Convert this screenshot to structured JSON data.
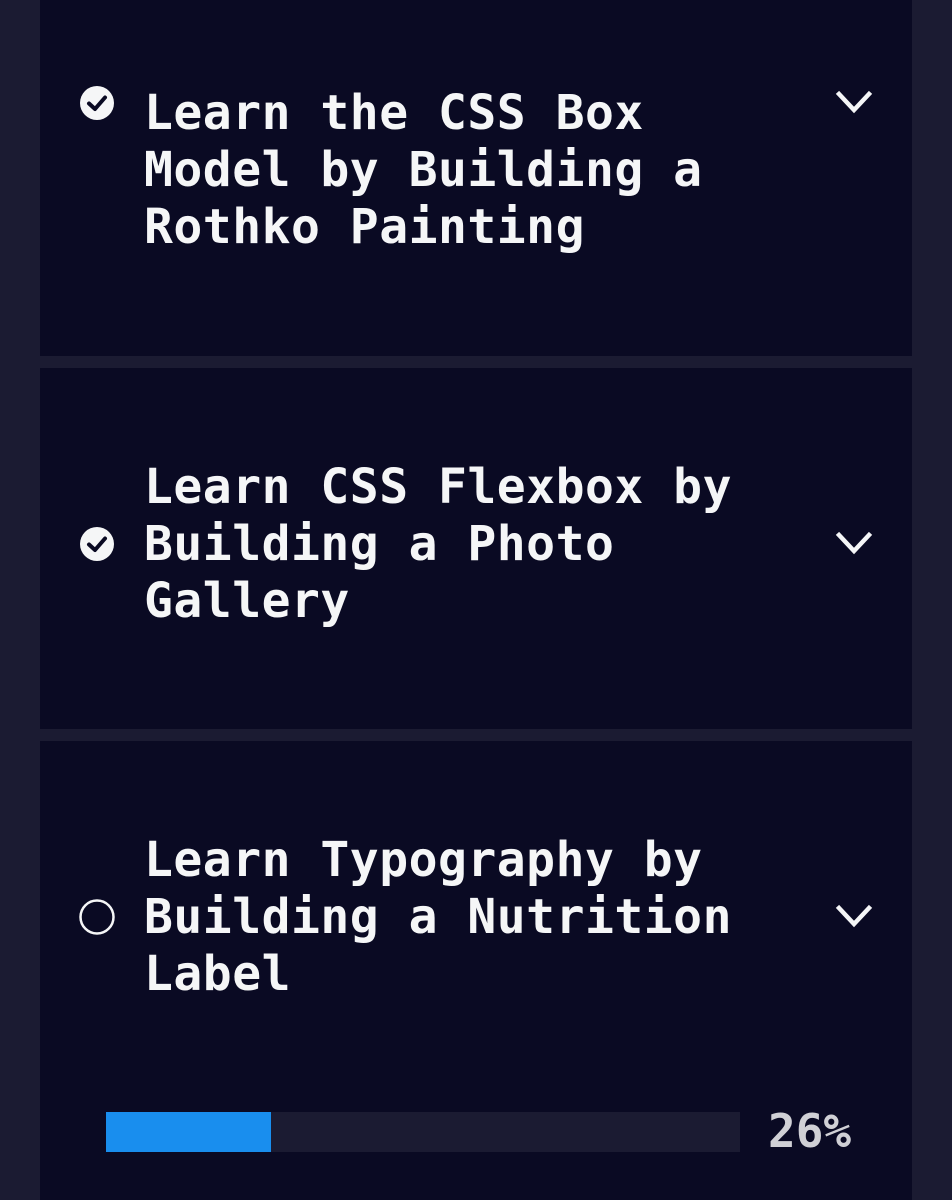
{
  "courses": [
    {
      "title": "Learn the CSS Box Model by Building a Rothko Painting",
      "completed": true,
      "status_icon": "check-circle-icon",
      "toggle_icon": "chevron-down-icon"
    },
    {
      "title": "Learn CSS Flexbox by Building a Photo Gallery",
      "completed": true,
      "status_icon": "check-circle-icon",
      "toggle_icon": "chevron-down-icon"
    },
    {
      "title": "Learn Typography by Building a Nutrition Label",
      "completed": false,
      "status_icon": "empty-circle-icon",
      "toggle_icon": "chevron-down-icon"
    }
  ],
  "progress": {
    "percent": 26,
    "label": "26%"
  },
  "colors": {
    "page_bg": "#1b1b32",
    "card_bg": "#0a0a23",
    "text": "#f5f6f7",
    "progress_fill": "#198eee",
    "progress_track": "#1b1b32"
  }
}
